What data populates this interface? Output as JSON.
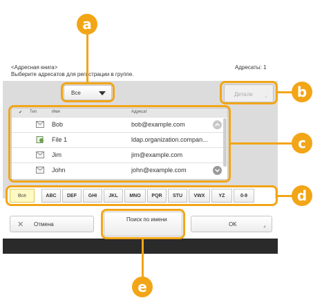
{
  "header": {
    "title": "<Адресная книга>",
    "subtitle": "Выберите адресатов для регистрации в группе.",
    "count_label": "Адресаты: 1"
  },
  "filter": {
    "selected": "Все"
  },
  "details_button": "Детали",
  "list": {
    "headers": {
      "check": "✔",
      "type": "Тип",
      "name": "Имя",
      "address": "Адресат"
    },
    "rows": [
      {
        "name": "Bob",
        "address": "bob@example.com",
        "icon": "email-icon"
      },
      {
        "name": "File 1",
        "address": "ldap.organization.compan...",
        "icon": "file-server-icon"
      },
      {
        "name": "Jim",
        "address": "jim@example.com",
        "icon": "email-icon"
      },
      {
        "name": "John",
        "address": "john@example.com",
        "icon": "email-icon"
      }
    ]
  },
  "tabs": [
    "Все",
    "ABC",
    "DEF",
    "GHI",
    "JKL",
    "MNO",
    "PQR",
    "STU",
    "VWX",
    "YZ",
    "0-9"
  ],
  "buttons": {
    "cancel": "Отмена",
    "search_by_name": "Поиск по имени",
    "ok": "OK"
  },
  "callouts": [
    "a",
    "b",
    "c",
    "d",
    "e"
  ],
  "colors": {
    "accent": "#f2a516",
    "active_tab": "#fff9c4",
    "footer_bar": "#2a2a2a"
  }
}
